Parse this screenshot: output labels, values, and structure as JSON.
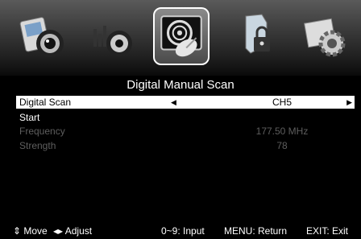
{
  "menu": {
    "icons": [
      "picture-icon",
      "sound-icon",
      "channel-icon",
      "lock-icon",
      "setup-icon"
    ],
    "selected_index": 2
  },
  "page": {
    "title": "Digital Manual Scan"
  },
  "rows": {
    "digital_scan": {
      "label": "Digital Scan",
      "value": "CH5",
      "left_arrow": "◀",
      "right_arrow": "▶"
    },
    "start": {
      "label": "Start"
    },
    "frequency": {
      "label": "Frequency",
      "value": "177.50 MHz"
    },
    "strength": {
      "label": "Strength",
      "value": "78"
    }
  },
  "footer": {
    "move": "⇕ Move",
    "adjust": "◂▸ Adjust",
    "input": "0~9: Input",
    "return": "MENU: Return",
    "exit": "EXIT: Exit"
  },
  "colors": {
    "background": "#000000",
    "highlight": "#ffffff",
    "dim_text": "#5e5e5e"
  }
}
